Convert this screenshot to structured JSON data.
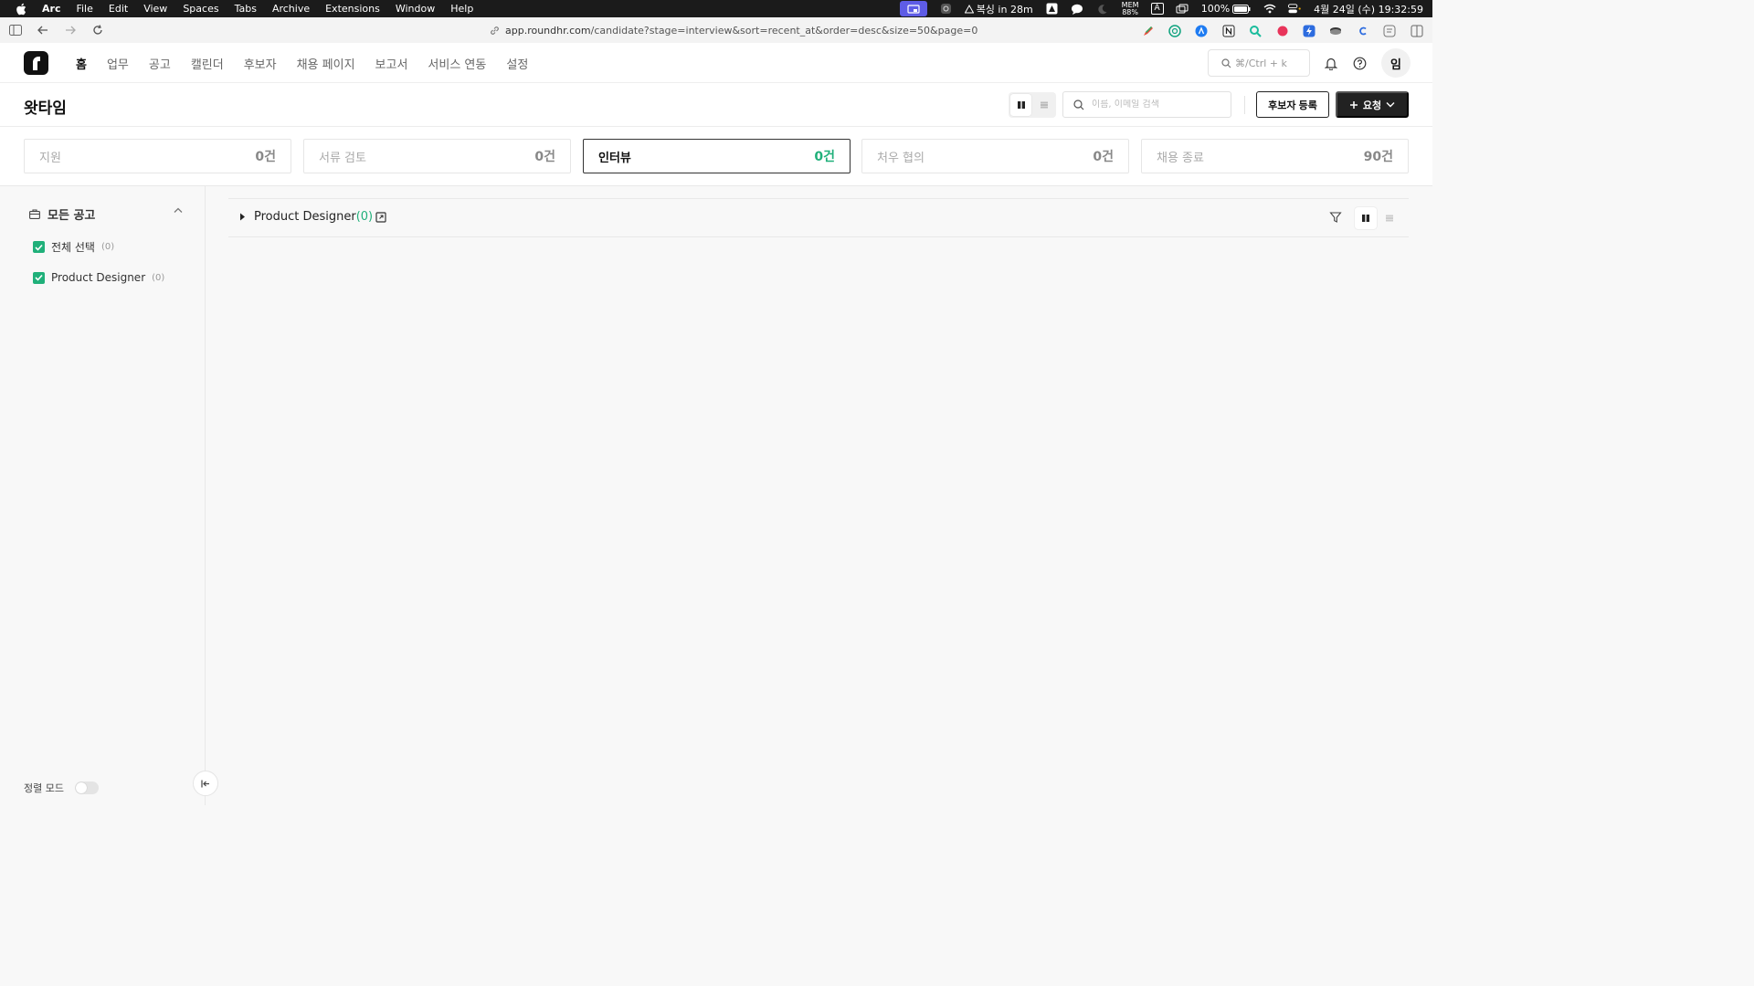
{
  "menubar": {
    "items": [
      "Arc",
      "File",
      "Edit",
      "View",
      "Spaces",
      "Tabs",
      "Archive",
      "Extensions",
      "Window",
      "Help"
    ],
    "reminder": "복싱 in 28m",
    "memory_label": "MEM",
    "memory_value": "88%",
    "input_source": "A",
    "battery": "100%",
    "datetime": "4월 24일 (수) 19:32:59"
  },
  "browser": {
    "url_host": "app.roundhr.com",
    "url_path": "/candidate?stage=interview&sort=recent_at&order=desc&size=50&page=0"
  },
  "header": {
    "logo_letter": "r",
    "nav": [
      "홈",
      "업무",
      "공고",
      "캘린더",
      "후보자",
      "채용 페이지",
      "보고서",
      "서비스 연동",
      "설정"
    ],
    "active_nav_index": 0,
    "command_search": "⌘/Ctrl + k",
    "avatar_initial": "임"
  },
  "page": {
    "title": "왓타임",
    "search_placeholder": "이름, 이메일 검색",
    "register_button": "후보자 등록",
    "request_button": "요청"
  },
  "stages": [
    {
      "label": "지원",
      "count": "0건",
      "active": false
    },
    {
      "label": "서류 검토",
      "count": "0건",
      "active": false
    },
    {
      "label": "인터뷰",
      "count": "0건",
      "active": true
    },
    {
      "label": "처우 협의",
      "count": "0건",
      "active": false
    },
    {
      "label": "채용 종료",
      "count": "90건",
      "active": false
    }
  ],
  "sidebar": {
    "section_title": "모든 공고",
    "items": [
      {
        "label": "전체 선택",
        "count": "(0)",
        "checked": true
      },
      {
        "label": "Product Designer",
        "count": "(0)",
        "checked": true
      }
    ],
    "footer_label": "정렬 모드"
  },
  "job_group": {
    "title": "Product Designer",
    "count": "(0)"
  },
  "colors": {
    "accent_green": "#20b07a",
    "menubar_bg": "#1b1b1b",
    "primary_dark": "#222222"
  }
}
